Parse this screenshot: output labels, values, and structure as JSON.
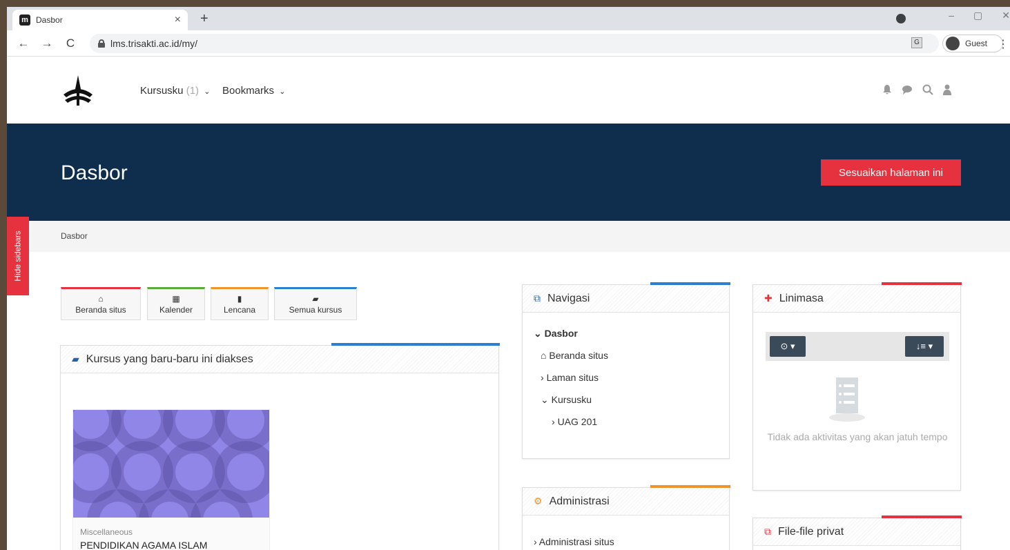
{
  "browser": {
    "tab_title": "Dasbor",
    "tab_favicon": "m",
    "tab_close": "×",
    "new_tab": "+",
    "url": "lms.trisakti.ac.id/my/",
    "back": "←",
    "forward": "→",
    "reload": "C",
    "profile_label": "Guest",
    "translate": "G",
    "menu": "⋮",
    "window_min": "–",
    "window_max": "▢",
    "window_close": "✕"
  },
  "topnav": {
    "courses_label": "Kursusku",
    "courses_count": "(1)",
    "bookmarks_label": "Bookmarks",
    "chevron": "⌄"
  },
  "hero": {
    "title": "Dasbor",
    "customize_label": "Sesuaikan halaman ini"
  },
  "breadcrumb": {
    "current": "Dasbor"
  },
  "sidebar_toggle": "Hide sidebars",
  "quick_buttons": [
    {
      "label": "Beranda situs",
      "icon": "home-icon",
      "glyph": "⌂",
      "color": "#e5323e"
    },
    {
      "label": "Kalender",
      "icon": "calendar-icon",
      "glyph": "▦",
      "color": "#5bab3a"
    },
    {
      "label": "Lencana",
      "icon": "bookmark-icon",
      "glyph": "▮",
      "color": "#f0932b"
    },
    {
      "label": "Semua kursus",
      "icon": "book-icon",
      "glyph": "▰",
      "color": "#2a7fd1"
    }
  ],
  "recent_courses": {
    "title": "Kursus yang baru-baru ini diakses",
    "icon": "book-icon",
    "accent": "#2a7fd1",
    "course": {
      "category": "Miscellaneous",
      "name": "PENDIDIKAN AGAMA ISLAM"
    }
  },
  "navigation": {
    "title": "Navigasi",
    "icon": "sitemap-icon",
    "accent": "#2a7fd1",
    "items": [
      "Dasbor",
      "Beranda situs",
      "Laman situs",
      "Kursusku",
      "UAG 201"
    ]
  },
  "administration": {
    "title": "Administrasi",
    "icon": "gears-icon",
    "accent": "#f0932b",
    "items": [
      "Administrasi situs"
    ]
  },
  "timeline": {
    "title": "Linimasa",
    "icon": "pin-icon",
    "accent": "#e5323e",
    "filter_label": "⊙ ▾",
    "sort_label": "↓≡ ▾",
    "empty_text": "Tidak ada aktivitas yang akan jatuh tempo"
  },
  "private_files": {
    "title": "File-file privat",
    "icon": "files-icon",
    "accent": "#e5323e"
  }
}
